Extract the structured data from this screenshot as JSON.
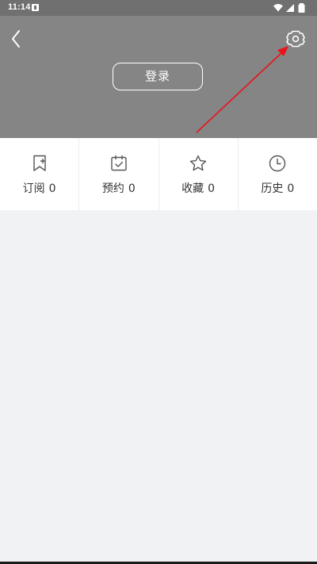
{
  "status_bar": {
    "time": "11:14",
    "icons": [
      "notification-icon",
      "wifi-icon",
      "signal-icon",
      "battery-icon"
    ]
  },
  "header": {
    "background": "#858585",
    "back_icon": "chevron-left-icon",
    "settings_icon": "gear-icon",
    "login_label": "登录"
  },
  "annotation": {
    "arrow_color": "#e8141b"
  },
  "quick_actions": [
    {
      "label": "订阅",
      "count": "0",
      "icon": "bookmark-plus-icon"
    },
    {
      "label": "预约",
      "count": "0",
      "icon": "calendar-check-icon"
    },
    {
      "label": "收藏",
      "count": "0",
      "icon": "star-icon"
    },
    {
      "label": "历史",
      "count": "0",
      "icon": "clock-icon"
    }
  ]
}
